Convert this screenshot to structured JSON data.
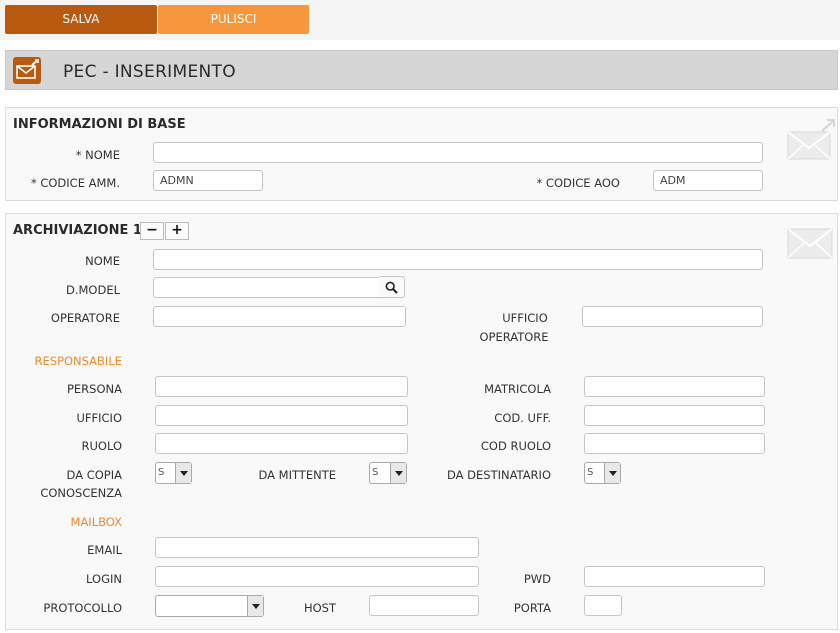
{
  "toolbar": {
    "save_label": "SALVA",
    "clear_label": "PULISCI"
  },
  "page": {
    "title": "PEC - INSERIMENTO"
  },
  "base": {
    "title": "INFORMAZIONI DI BASE",
    "nome_label": "* NOME",
    "nome_value": "",
    "codice_amm_label": "* CODICE AMM.",
    "codice_amm_value": "ADMN",
    "codice_aoo_label": "* CODICE AOO",
    "codice_aoo_value": "ADM"
  },
  "archiviazione": {
    "title": "ARCHIVIAZIONE 1",
    "minus_label": "−",
    "plus_label": "+",
    "nome_label": "NOME",
    "dmodel_label": "D.MODEL",
    "operatore_label": "OPERATORE",
    "ufficio_operatore_label_1": "UFFICIO",
    "ufficio_operatore_label_2": "OPERATORE",
    "responsabile": {
      "title": "RESPONSABILE",
      "persona_label": "PERSONA",
      "matricola_label": "MATRICOLA",
      "ufficio_label": "UFFICIO",
      "cod_uff_label": "COD. UFF.",
      "ruolo_label": "RUOLO",
      "cod_ruolo_label": "COD RUOLO",
      "da_copia_label_1": "DA COPIA",
      "da_copia_label_2": "CONOSCENZA",
      "da_copia_value": "S",
      "da_mittente_label": "DA MITTENTE",
      "da_mittente_value": "S",
      "da_destinatario_label": "DA DESTINATARIO",
      "da_destinatario_value": "S"
    },
    "mailbox": {
      "title": "MAILBOX",
      "email_label": "EMAIL",
      "login_label": "LOGIN",
      "pwd_label": "PWD",
      "protocollo_label": "PROTOCOLLO",
      "host_label": "HOST",
      "porta_label": "PORTA"
    }
  },
  "colors": {
    "dark_orange": "#b85a10",
    "orange": "#f7963b",
    "accent_text": "#f08a2a"
  },
  "icons": {
    "header": "mail-icon",
    "section1": "mail-send-icon",
    "section2": "mail-icon",
    "search": "search-icon"
  }
}
